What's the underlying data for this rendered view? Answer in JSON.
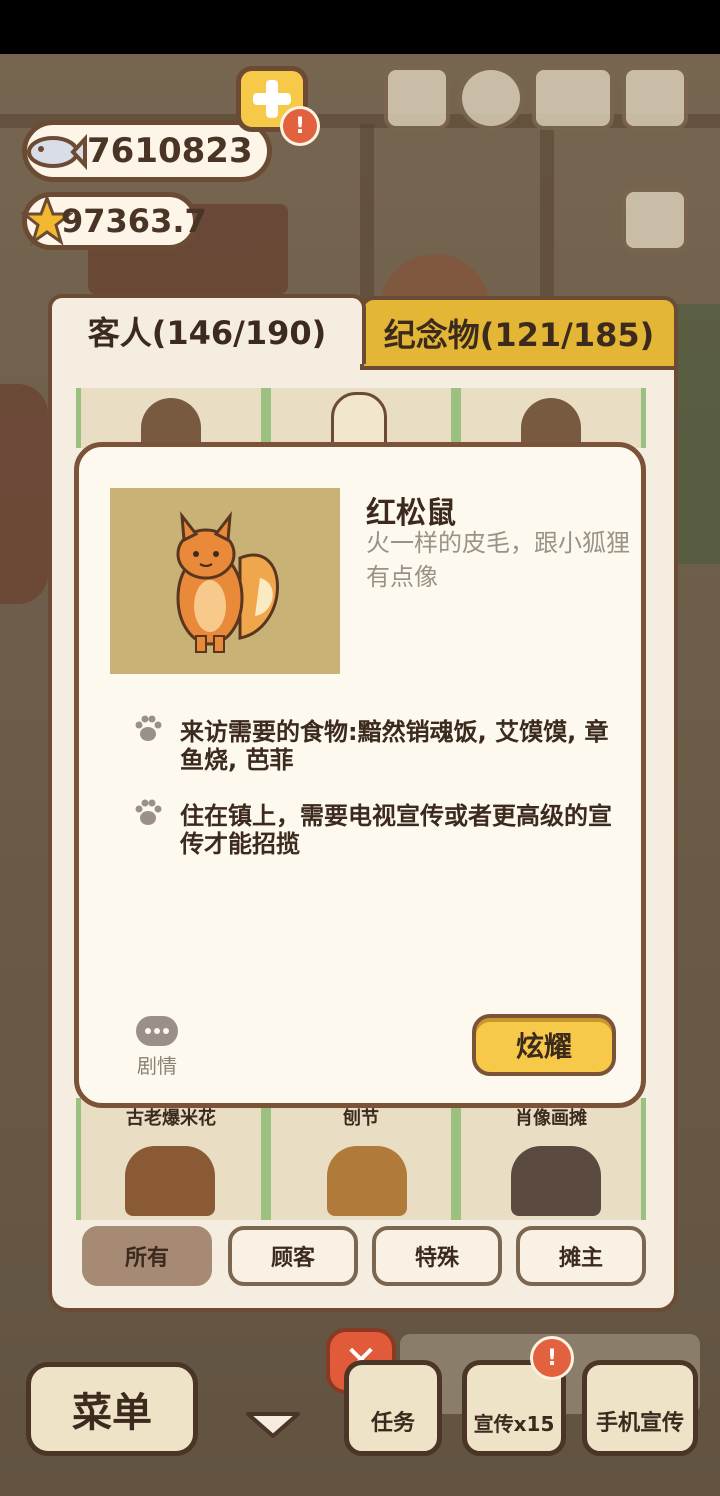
{
  "hud": {
    "fish_count": "7610823",
    "star_count": "97363.7",
    "alert_mark": "!"
  },
  "tabs": {
    "guests": "客人(146/190)",
    "souvenirs": "纪念物(121/185)"
  },
  "background_cards": [
    "古老爆米花",
    "刨节",
    "肖像画摊"
  ],
  "filters": {
    "all": "所有",
    "customer": "顾客",
    "special": "特殊",
    "stall_owner": "摊主"
  },
  "detail": {
    "name": "红松鼠",
    "description": "火一样的皮毛，跟小狐狸有点像",
    "requirements": [
      "来访需要的食物:黯然销魂饭, 艾馍馍, 章鱼烧, 芭菲",
      "住在镇上，需要电视宣传或者更高级的宣传才能招揽"
    ],
    "story_label": "剧情",
    "show_button": "炫耀"
  },
  "close_glyph": "✕",
  "bottom_bar": {
    "menu": "菜单",
    "task": "任务",
    "promo": "宣传x15",
    "phone_promo": "手机宣传"
  },
  "colors": {
    "accent_yellow": "#f7c948",
    "close_red": "#e15a3a",
    "panel_brown": "#6b4b33"
  }
}
